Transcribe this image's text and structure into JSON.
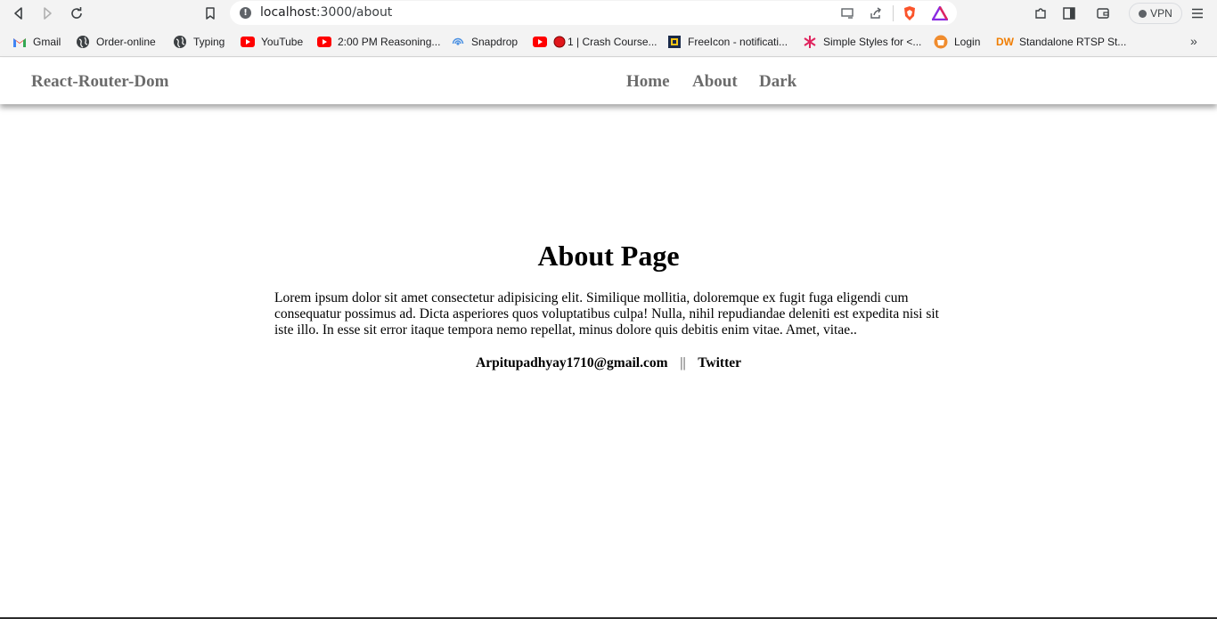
{
  "browser": {
    "url_host": "localhost",
    "url_path": ":3000/about",
    "vpn_label": "VPN",
    "more_bookmarks": "»",
    "bookmarks": [
      {
        "label": "Gmail",
        "icon": "gmail-icon"
      },
      {
        "label": "Order-online",
        "icon": "globe-icon"
      },
      {
        "label": "Typing",
        "icon": "globe-icon"
      },
      {
        "label": "YouTube",
        "icon": "youtube-icon"
      },
      {
        "label": "2:00 PM Reasoning...",
        "icon": "youtube-icon"
      },
      {
        "label": "Snapdrop",
        "icon": "snapdrop-icon"
      },
      {
        "label": "1 | Crash Course...",
        "icon": "youtube-icon"
      },
      {
        "label": "FreeIcon - notificati...",
        "icon": "freeicon-icon"
      },
      {
        "label": "Simple Styles for <...",
        "icon": "asterisk-icon"
      },
      {
        "label": "Login",
        "icon": "login-icon"
      },
      {
        "label": "Standalone RTSP St...",
        "icon": "dw-icon"
      }
    ]
  },
  "navbar": {
    "brand": "React-Router-Dom",
    "links": [
      "Home",
      "About",
      "Dark"
    ]
  },
  "main": {
    "title": "About Page",
    "paragraph": "Lorem ipsum dolor sit amet consectetur adipisicing elit. Similique mollitia, doloremque ex fugit fuga eligendi cum consequatur possimus ad. Dicta asperiores quos voluptatibus culpa! Nulla, nihil repudiandae deleniti est expedita nisi sit iste illo. In esse sit error itaque tempora nemo repellat, minus dolore quis debitis enim vitae. Amet, vitae..",
    "email": "Arpitupadhyay1710@gmail.com",
    "separator": "||",
    "twitter": "Twitter"
  },
  "colors": {
    "nav_text": "#6b6b6b",
    "chrome_bg": "#f3f3f3",
    "youtube_red": "#ff0000",
    "brave_orange": "#fb542b"
  }
}
